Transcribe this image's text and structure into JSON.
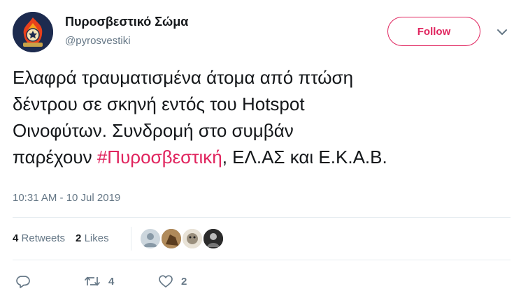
{
  "account": {
    "display_name": "Πυροσβεστικό Σώμα",
    "handle": "@pyrosvestiki"
  },
  "follow_button": {
    "label": "Follow"
  },
  "tweet": {
    "lines": [
      "Ελαφρά τραυματισμένα άτομα από πτώση",
      "δέντρου σε σκηνή εντός του Hotspot",
      "Οινοφύτων. Συνδρομή στο συμβάν"
    ],
    "last_line_prefix": "παρέχουν ",
    "hashtag": "#Πυροσβεστική",
    "last_line_suffix": ", ΕΛ.ΑΣ και Ε.Κ.Α.Β.",
    "timestamp": "10:31 AM - 10 Jul 2019"
  },
  "stats": {
    "retweets_count": "4",
    "retweets_label": "Retweets",
    "likes_count": "2",
    "likes_label": "Likes"
  },
  "actions": {
    "reply_icon": "reply-icon",
    "retweet_icon": "retweet-icon",
    "retweet_count": "4",
    "like_icon": "heart-icon",
    "like_count": "2"
  },
  "colors": {
    "accent": "#e0245e",
    "secondary_text": "#657786",
    "primary_text": "#14171a",
    "divider": "#e6ecf0"
  }
}
